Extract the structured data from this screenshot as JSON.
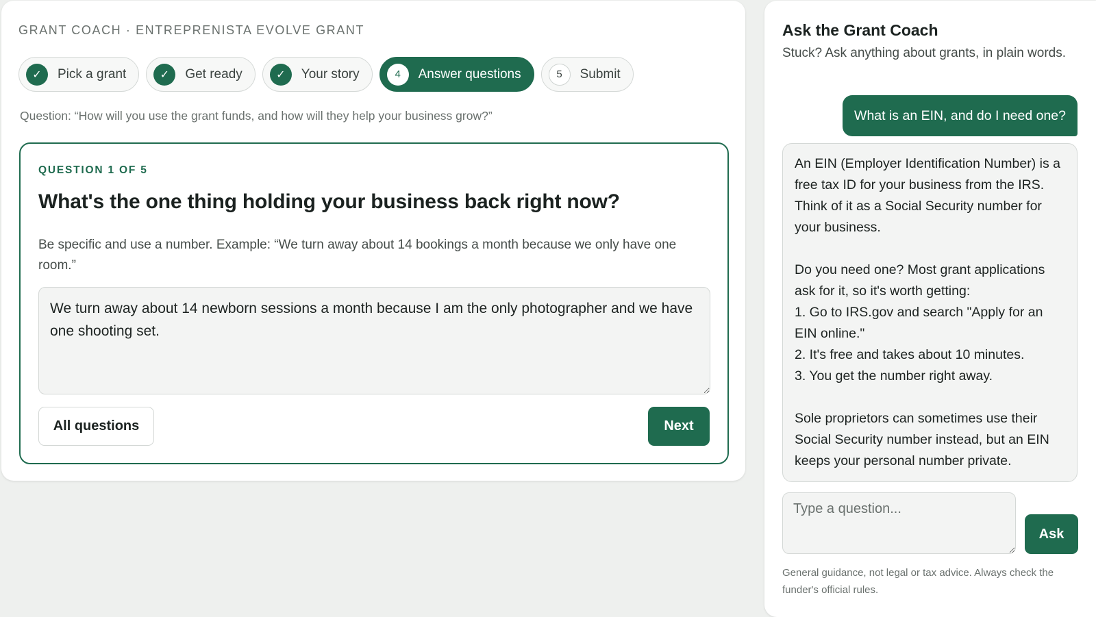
{
  "main": {
    "eyebrow": "GRANT COACH · ENTREPRENISTA EVOLVE GRANT",
    "steps": [
      {
        "label": "Pick a grant",
        "marker": "✓",
        "state": "done"
      },
      {
        "label": "Get ready",
        "marker": "✓",
        "state": "done"
      },
      {
        "label": "Your story",
        "marker": "✓",
        "state": "done"
      },
      {
        "label": "Answer questions",
        "marker": "4",
        "state": "active"
      },
      {
        "label": "Submit",
        "marker": "5",
        "state": "todo"
      }
    ],
    "question_ref": "Question: “How will you use the grant funds, and how will they help your business grow?”",
    "question_card": {
      "counter": "QUESTION 1 OF 5",
      "title": "What's the one thing holding your business back right now?",
      "hint": "Be specific and use a number. Example: “We turn away about 14 bookings a month because we only have one room.”",
      "answer_value": "We turn away about 14 newborn sessions a month because I am the only photographer and we have one shooting set.",
      "all_questions_label": "All questions",
      "next_label": "Next"
    }
  },
  "coach": {
    "title": "Ask the Grant Coach",
    "subtitle": "Stuck? Ask anything about grants, in plain words.",
    "user_message": "What is an EIN, and do I need one?",
    "bot_reply": {
      "para1": "An EIN (Employer Identification Number) is a free tax ID for your business from the IRS. Think of it as a Social Security number for your business.",
      "para2_intro": "Do you need one? Most grant applications ask for it, so it's worth getting:",
      "steps": [
        "1. Go to IRS.gov and search \"Apply for an EIN online.\"",
        "2. It's free and takes about 10 minutes.",
        "3. You get the number right away."
      ],
      "para3": "Sole proprietors can sometimes use their Social Security number instead, but an EIN keeps your personal number private."
    },
    "input_placeholder": "Type a question...",
    "ask_label": "Ask",
    "disclaimer": "General guidance, not legal or tax advice. Always check the funder's official rules."
  },
  "colors": {
    "brand_green": "#1f6b4f",
    "page_bg": "#eef0ee",
    "muted_text": "#6a716e"
  },
  "icons": {
    "step_done": "check-icon"
  }
}
